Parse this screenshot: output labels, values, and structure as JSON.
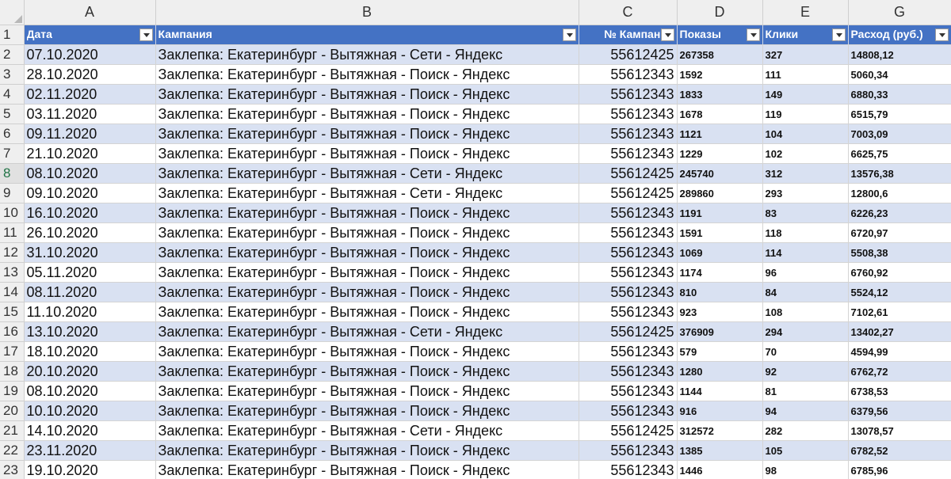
{
  "columns": [
    "A",
    "B",
    "C",
    "D",
    "E",
    "G"
  ],
  "col_letters": {
    "A": "A",
    "B": "B",
    "C": "C",
    "D": "D",
    "E": "E",
    "G": "G"
  },
  "header_row_num": "1",
  "headers": {
    "date": "Дата",
    "campaign": "Кампания",
    "campaign_no": "№ Кампании",
    "impressions": "Показы",
    "clicks": "Клики",
    "spend": "Расход (руб.)"
  },
  "rows": [
    {
      "n": "2",
      "date": "07.10.2020",
      "campaign": "Заклепка: Екатеринбург - Вытяжная - Сети - Яндекс",
      "id": "55612425",
      "imp": "267358",
      "clicks": "327",
      "spend": "14808,12"
    },
    {
      "n": "3",
      "date": "28.10.2020",
      "campaign": "Заклепка: Екатеринбург - Вытяжная - Поиск - Яндекс",
      "id": "55612343",
      "imp": "1592",
      "clicks": "111",
      "spend": "5060,34"
    },
    {
      "n": "4",
      "date": "02.11.2020",
      "campaign": "Заклепка: Екатеринбург - Вытяжная - Поиск - Яндекс",
      "id": "55612343",
      "imp": "1833",
      "clicks": "149",
      "spend": "6880,33"
    },
    {
      "n": "5",
      "date": "03.11.2020",
      "campaign": "Заклепка: Екатеринбург - Вытяжная - Поиск - Яндекс",
      "id": "55612343",
      "imp": "1678",
      "clicks": "119",
      "spend": "6515,79"
    },
    {
      "n": "6",
      "date": "09.11.2020",
      "campaign": "Заклепка: Екатеринбург - Вытяжная - Поиск - Яндекс",
      "id": "55612343",
      "imp": "1121",
      "clicks": "104",
      "spend": "7003,09"
    },
    {
      "n": "7",
      "date": "21.10.2020",
      "campaign": "Заклепка: Екатеринбург - Вытяжная - Поиск - Яндекс",
      "id": "55612343",
      "imp": "1229",
      "clicks": "102",
      "spend": "6625,75"
    },
    {
      "n": "8",
      "date": "08.10.2020",
      "campaign": "Заклепка: Екатеринбург - Вытяжная - Сети - Яндекс",
      "id": "55612425",
      "imp": "245740",
      "clicks": "312",
      "spend": "13576,38"
    },
    {
      "n": "9",
      "date": "09.10.2020",
      "campaign": "Заклепка: Екатеринбург - Вытяжная - Сети - Яндекс",
      "id": "55612425",
      "imp": "289860",
      "clicks": "293",
      "spend": "12800,6"
    },
    {
      "n": "10",
      "date": "16.10.2020",
      "campaign": "Заклепка: Екатеринбург - Вытяжная - Поиск - Яндекс",
      "id": "55612343",
      "imp": "1191",
      "clicks": "83",
      "spend": "6226,23"
    },
    {
      "n": "11",
      "date": "26.10.2020",
      "campaign": "Заклепка: Екатеринбург - Вытяжная - Поиск - Яндекс",
      "id": "55612343",
      "imp": "1591",
      "clicks": "118",
      "spend": "6720,97"
    },
    {
      "n": "12",
      "date": "31.10.2020",
      "campaign": "Заклепка: Екатеринбург - Вытяжная - Поиск - Яндекс",
      "id": "55612343",
      "imp": "1069",
      "clicks": "114",
      "spend": "5508,38"
    },
    {
      "n": "13",
      "date": "05.11.2020",
      "campaign": "Заклепка: Екатеринбург - Вытяжная - Поиск - Яндекс",
      "id": "55612343",
      "imp": "1174",
      "clicks": "96",
      "spend": "6760,92"
    },
    {
      "n": "14",
      "date": "08.11.2020",
      "campaign": "Заклепка: Екатеринбург - Вытяжная - Поиск - Яндекс",
      "id": "55612343",
      "imp": "810",
      "clicks": "84",
      "spend": "5524,12"
    },
    {
      "n": "15",
      "date": "11.10.2020",
      "campaign": "Заклепка: Екатеринбург - Вытяжная - Поиск - Яндекс",
      "id": "55612343",
      "imp": "923",
      "clicks": "108",
      "spend": "7102,61"
    },
    {
      "n": "16",
      "date": "13.10.2020",
      "campaign": "Заклепка: Екатеринбург - Вытяжная - Сети - Яндекс",
      "id": "55612425",
      "imp": "376909",
      "clicks": "294",
      "spend": "13402,27"
    },
    {
      "n": "17",
      "date": "18.10.2020",
      "campaign": "Заклепка: Екатеринбург - Вытяжная - Поиск - Яндекс",
      "id": "55612343",
      "imp": "579",
      "clicks": "70",
      "spend": "4594,99"
    },
    {
      "n": "18",
      "date": "20.10.2020",
      "campaign": "Заклепка: Екатеринбург - Вытяжная - Поиск - Яндекс",
      "id": "55612343",
      "imp": "1280",
      "clicks": "92",
      "spend": "6762,72"
    },
    {
      "n": "19",
      "date": "08.10.2020",
      "campaign": "Заклепка: Екатеринбург - Вытяжная - Поиск - Яндекс",
      "id": "55612343",
      "imp": "1144",
      "clicks": "81",
      "spend": "6738,53"
    },
    {
      "n": "20",
      "date": "10.10.2020",
      "campaign": "Заклепка: Екатеринбург - Вытяжная - Поиск - Яндекс",
      "id": "55612343",
      "imp": "916",
      "clicks": "94",
      "spend": "6379,56"
    },
    {
      "n": "21",
      "date": "14.10.2020",
      "campaign": "Заклепка: Екатеринбург - Вытяжная - Сети - Яндекс",
      "id": "55612425",
      "imp": "312572",
      "clicks": "282",
      "spend": "13078,57"
    },
    {
      "n": "22",
      "date": "23.11.2020",
      "campaign": "Заклепка: Екатеринбург - Вытяжная - Поиск - Яндекс",
      "id": "55612343",
      "imp": "1385",
      "clicks": "105",
      "spend": "6782,52"
    },
    {
      "n": "23",
      "date": "19.10.2020",
      "campaign": "Заклепка: Екатеринбург - Вытяжная - Поиск - Яндекс",
      "id": "55612343",
      "imp": "1446",
      "clicks": "98",
      "spend": "6785,96"
    },
    {
      "n": "24",
      "date": "",
      "campaign": "",
      "id": "",
      "imp": "",
      "clicks": "",
      "spend": ""
    }
  ],
  "colors": {
    "header_fill": "#4472c4",
    "band_fill": "#d9e1f2",
    "active_row_label": "#217346"
  },
  "active_row": "8",
  "icons": {
    "filter": "filter-dropdown-icon",
    "select_all": "select-all-corner-icon"
  }
}
